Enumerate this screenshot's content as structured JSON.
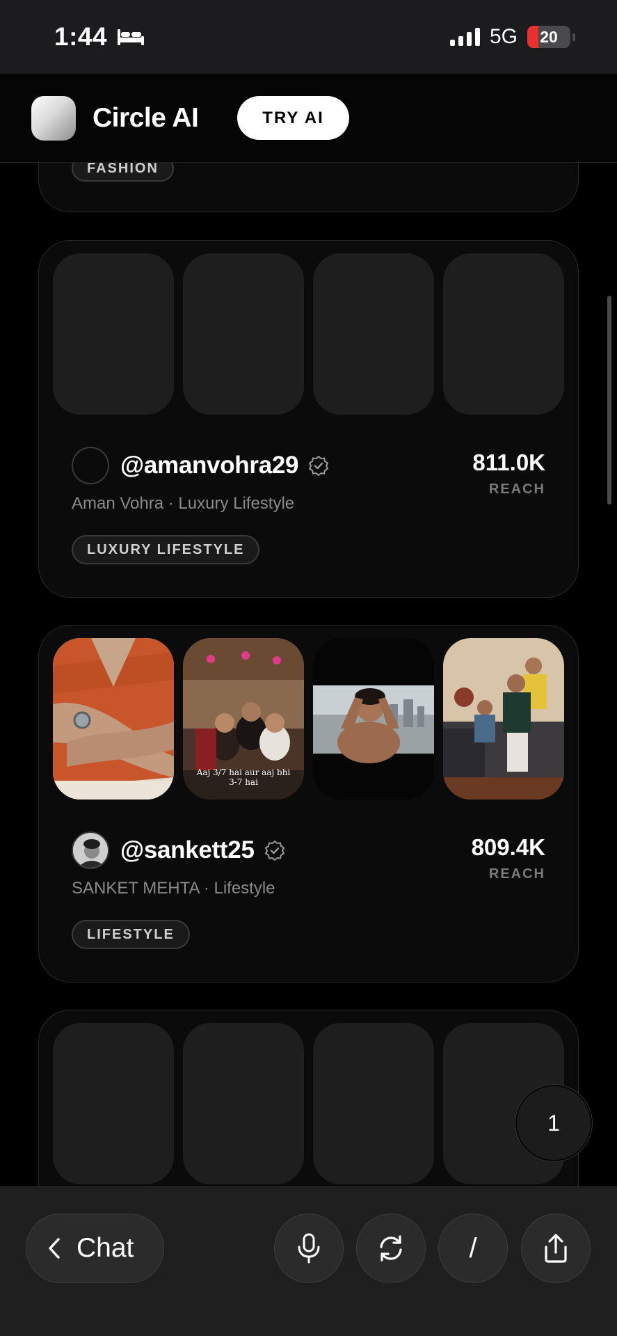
{
  "status_bar": {
    "time": "1:44",
    "network": "5G",
    "battery_level": "20",
    "icons": [
      "bed-icon",
      "signal-icon",
      "battery-icon"
    ]
  },
  "header": {
    "brand": "Circle AI",
    "try_button": "TRY AI"
  },
  "cards": [
    {
      "tag": "FASHION"
    },
    {
      "handle": "@amanvohra29",
      "subtitle": "Aman Vohra · Luxury Lifestyle",
      "reach_value": "811.0K",
      "reach_label": "REACH",
      "tag": "LUXURY LIFESTYLE"
    },
    {
      "handle": "@sankett25",
      "subtitle": "SANKET MEHTA · Lifestyle",
      "reach_value": "809.4K",
      "reach_label": "REACH",
      "tag": "LIFESTYLE",
      "thumb_caption": "Aaj 3/7 hai aur aaj bhi 3-7 hai"
    }
  ],
  "page_badge": "1",
  "toolbar": {
    "chat_label": "Chat",
    "slash_label": "/",
    "icons": [
      "chevron-left-icon",
      "microphone-icon",
      "refresh-icon",
      "share-icon"
    ]
  },
  "colors": {
    "background": "#000000",
    "card": "#0b0b0b",
    "battery_red": "#e9302f"
  }
}
